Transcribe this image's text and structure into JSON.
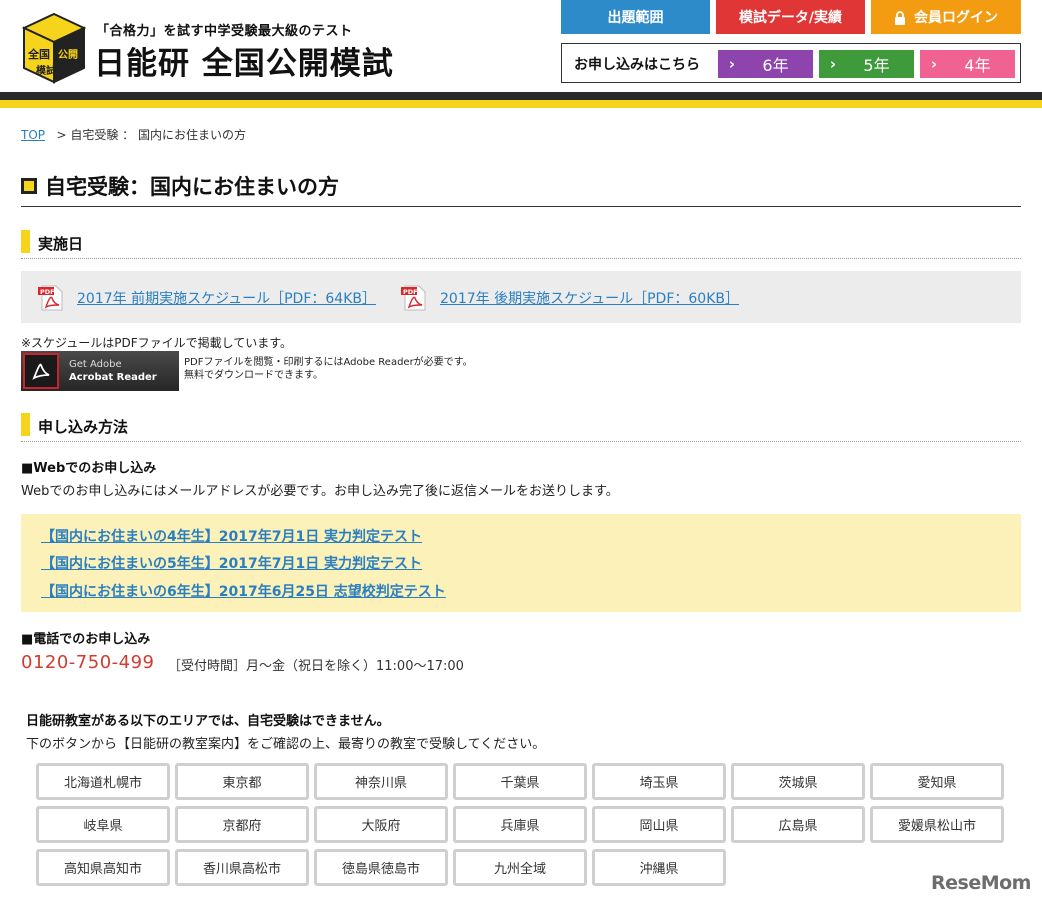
{
  "header": {
    "tagline": "「合格力」を試す中学受験最大級のテスト",
    "site_title": "日能研 全国公開模試",
    "logo_text": "全国公開模試",
    "nav": {
      "scope_label": "出題範囲",
      "data_label": "模試データ/実績",
      "login_label": "会員ログイン"
    },
    "apply": {
      "label": "お申し込みはこちら",
      "grades": [
        {
          "label": "6年",
          "color": "#8e44ad"
        },
        {
          "label": "5年",
          "color": "#3f9a3c"
        },
        {
          "label": "4年",
          "color": "#f06292"
        }
      ]
    }
  },
  "breadcrumb": {
    "top": "TOP",
    "separator": ">",
    "current": "自宅受験 ： 国内にお住まいの方"
  },
  "page_title": "自宅受験：国内にお住まいの方",
  "schedule": {
    "heading": "実施日",
    "pdf_links": [
      "2017年 前期実施スケジュール［PDF：64KB］",
      "2017年 後期実施スケジュール［PDF：60KB］"
    ],
    "pdf_icon_label": "PDF",
    "note": "※スケジュールはPDFファイルで掲載しています。",
    "acrobat": {
      "line1": "Get Adobe",
      "line2": "Acrobat Reader",
      "desc1": "PDFファイルを閲覧・印刷するにはAdobe Readerが必要です。",
      "desc2": "無料でダウンロードできます。"
    }
  },
  "apply_method": {
    "heading": "申し込み方法",
    "web_heading": "■Webでのお申し込み",
    "web_text": "Webでのお申し込みにはメールアドレスが必要です。お申し込み完了後に返信メールをお送りします。",
    "web_links": [
      "【国内にお住まいの4年生】2017年7月1日 実力判定テスト",
      "【国内にお住まいの5年生】2017年7月1日 実力判定テスト",
      "【国内にお住まいの6年生】2017年6月25日 志望校判定テスト"
    ],
    "phone_heading": "■電話でのお申し込み",
    "phone": "0120-750-499",
    "hours": "［受付時間］月～金（祝日を除く）11:00～17:00"
  },
  "areas": {
    "warning_bold": "日能研教室がある以下のエリアでは、自宅受験はできません。",
    "warning_text": "下のボタンから【日能研の教室案内】をご確認の上、最寄りの教室で受験してください。",
    "buttons": [
      "北海道札幌市",
      "東京都",
      "神奈川県",
      "千葉県",
      "埼玉県",
      "茨城県",
      "愛知県",
      "岐阜県",
      "京都府",
      "大阪府",
      "兵庫県",
      "岡山県",
      "広島県",
      "愛媛県松山市",
      "高知県高知市",
      "香川県高松市",
      "徳島県徳島市",
      "九州全域",
      "沖縄県"
    ]
  },
  "watermark": "ReseMom",
  "colors": {
    "accent_yellow": "#f7d41c",
    "link_blue": "#2a7fc1",
    "phone_red": "#d43a2e"
  }
}
